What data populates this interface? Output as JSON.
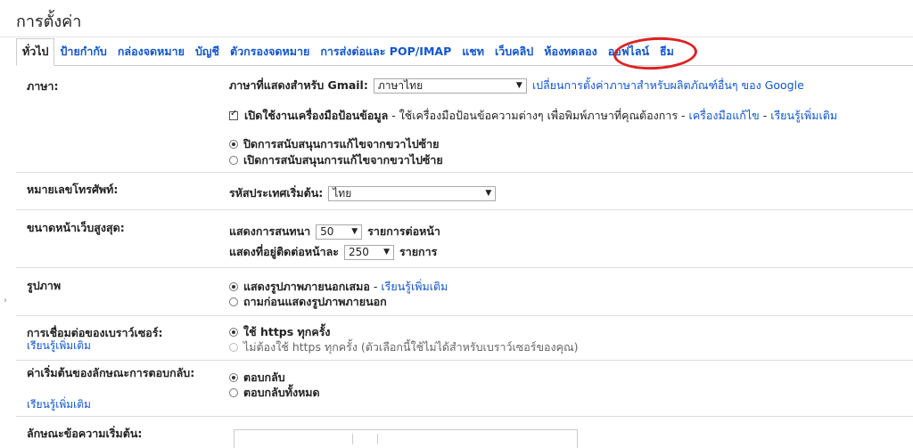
{
  "page": {
    "title": "การตั้งค่า"
  },
  "tabs": [
    {
      "label": "ทั่วไป"
    },
    {
      "label": "ป้ายกำกับ"
    },
    {
      "label": "กล่องจดหมาย"
    },
    {
      "label": "บัญชี"
    },
    {
      "label": "ตัวกรองจดหมาย"
    },
    {
      "label": "การส่งต่อและ POP/IMAP"
    },
    {
      "label": "แชท"
    },
    {
      "label": "เว็บคลิป"
    },
    {
      "label": "ห้องทดลอง"
    },
    {
      "label": "ออฟไลน์"
    },
    {
      "label": "ธีม"
    }
  ],
  "language": {
    "label": "ภาษา:",
    "display_label": "ภาษาที่แสดงสำหรับ Gmail:",
    "selected": "ภาษาไทย",
    "change_link": "เปลี่ยนการตั้งค่าภาษาสำหรับผลิตภัณฑ์อื่นๆ ของ Google",
    "input_tools_bold": "เปิดใช้งานเครื่องมือป้อนข้อมูล",
    "input_tools_desc": " - ใช้เครื่องมือป้อนข้อความต่างๆ เพื่อพิมพ์ภาษาที่คุณต้องการ - ",
    "input_tools_edit_link": "เครื่องมือแก้ไข",
    "dash": " - ",
    "learn_more": "เรียนรู้เพิ่มเติม",
    "rtl_off": "ปิดการสนับสนุนการแก้ไขจากขวาไปซ้าย",
    "rtl_on": "เปิดการสนับสนุนการแก้ไขจากขวาไปซ้าย"
  },
  "phone": {
    "label": "หมายเลขโทรศัพท์:",
    "country_label": "รหัสประเทศเริ่มต้น:",
    "selected": "ไทย"
  },
  "page_size": {
    "label": "ขนาดหน้าเว็บสูงสุด:",
    "conv_prefix": "แสดงการสนทนา",
    "conv_value": "50",
    "conv_suffix": "รายการต่อหน้า",
    "contacts_prefix": "แสดงที่อยู่ติดต่อหน้าละ",
    "contacts_value": "250",
    "contacts_suffix": "รายการ"
  },
  "images": {
    "label": "รูปภาพ",
    "always_show": "แสดงรูปภาพภายนอกเสมอ",
    "dash": " - ",
    "learn_more": "เรียนรู้เพิ่มเติม",
    "ask_before": "ถามก่อนแสดงรูปภาพภายนอก"
  },
  "browser": {
    "label": "การเชื่อมต่อของเบราว์เซอร์:",
    "learn_more": "เรียนรู้เพิ่มเติม",
    "always_https": "ใช้ https ทุกครั้ง",
    "no_https": "ไม่ต้องใช้ https ทุกครั้ง (ตัวเลือกนี้ใช้ไม่ได้สำหรับเบราว์เซอร์ของคุณ)"
  },
  "reply": {
    "label": "ค่าเริ่มต้นของลักษณะการตอบกลับ:",
    "learn_more": "เรียนรู้เพิ่มเติม",
    "reply": "ตอบกลับ",
    "reply_all": "ตอบกลับทั้งหมด"
  },
  "text_style": {
    "label": "ลักษณะข้อความเริ่มต้น:"
  }
}
